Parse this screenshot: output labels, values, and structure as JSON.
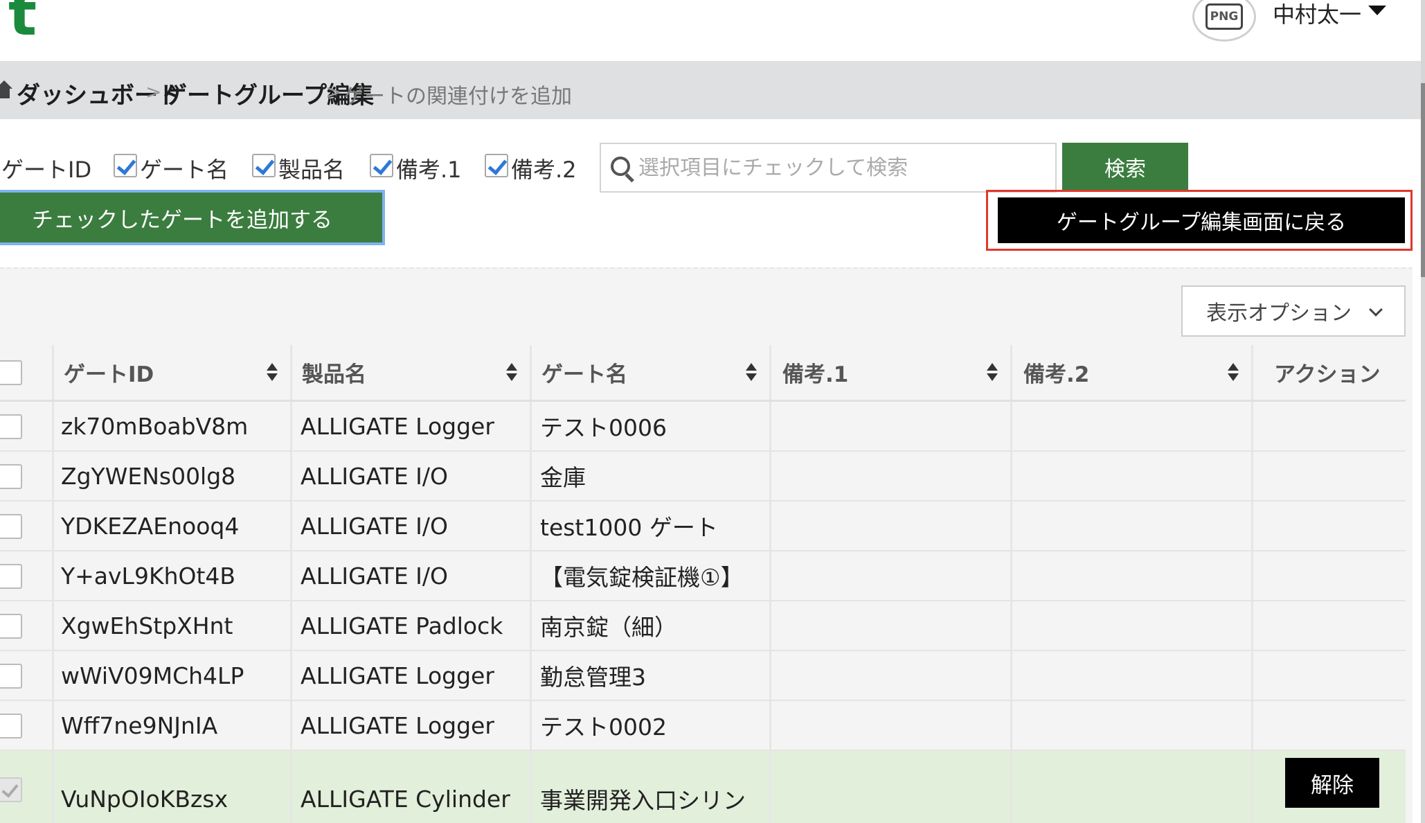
{
  "header": {
    "logo_text": "t",
    "avatar_text": "PNG",
    "user_name": "中村太一"
  },
  "breadcrumb": {
    "items": [
      "ダッシュボード",
      "ゲートグループ編集"
    ],
    "current": "ゲートの関連付けを追加",
    "separator": ">"
  },
  "filters": {
    "gate_id_label": "ゲートID",
    "checks": [
      {
        "label": "ゲート名",
        "checked": true
      },
      {
        "label": "製品名",
        "checked": true
      },
      {
        "label": "備考.1",
        "checked": true
      },
      {
        "label": "備考.2",
        "checked": true
      }
    ],
    "search_placeholder": "選択項目にチェックして検索",
    "search_button": "検索"
  },
  "actions": {
    "add_checked": "チェックしたゲートを追加する",
    "back_to_edit": "ゲートグループ編集画面に戻る",
    "display_options": "表示オプション"
  },
  "table": {
    "headers": [
      "ゲートID",
      "製品名",
      "ゲート名",
      "備考.1",
      "備考.2",
      "アクション"
    ],
    "rows": [
      {
        "gate_id": "zk70mBoabV8m",
        "product": "ALLIGATE Logger",
        "gate_name": "テスト0006",
        "note1": "",
        "note2": "",
        "selected": false
      },
      {
        "gate_id": "ZgYWENs00lg8",
        "product": "ALLIGATE I/O",
        "gate_name": "金庫",
        "note1": "",
        "note2": "",
        "selected": false
      },
      {
        "gate_id": "YDKEZAEnooq4",
        "product": "ALLIGATE I/O",
        "gate_name": "test1000 ゲート",
        "note1": "",
        "note2": "",
        "selected": false
      },
      {
        "gate_id": "Y+avL9KhOt4B",
        "product": "ALLIGATE I/O",
        "gate_name": "【電気錠検証機①】",
        "note1": "",
        "note2": "",
        "selected": false
      },
      {
        "gate_id": "XgwEhStpXHnt",
        "product": "ALLIGATE Padlock",
        "gate_name": "南京錠（細）",
        "note1": "",
        "note2": "",
        "selected": false
      },
      {
        "gate_id": "wWiV09MCh4LP",
        "product": "ALLIGATE Logger",
        "gate_name": "勤怠管理3",
        "note1": "",
        "note2": "",
        "selected": false
      },
      {
        "gate_id": "Wff7ne9NJnIA",
        "product": "ALLIGATE Logger",
        "gate_name": "テスト0002",
        "note1": "",
        "note2": "",
        "selected": false
      },
      {
        "gate_id": "VuNpOIoKBzsx",
        "product": "ALLIGATE Cylinder",
        "gate_name": "事業開発入口シリン",
        "note1": "",
        "note2": "",
        "selected": true,
        "action": "解除"
      }
    ]
  },
  "colors": {
    "green": "#3b7d3f",
    "logo_green": "#1a8a3c",
    "highlight_red": "#e0382c",
    "selected_row": "#e2efdb"
  }
}
